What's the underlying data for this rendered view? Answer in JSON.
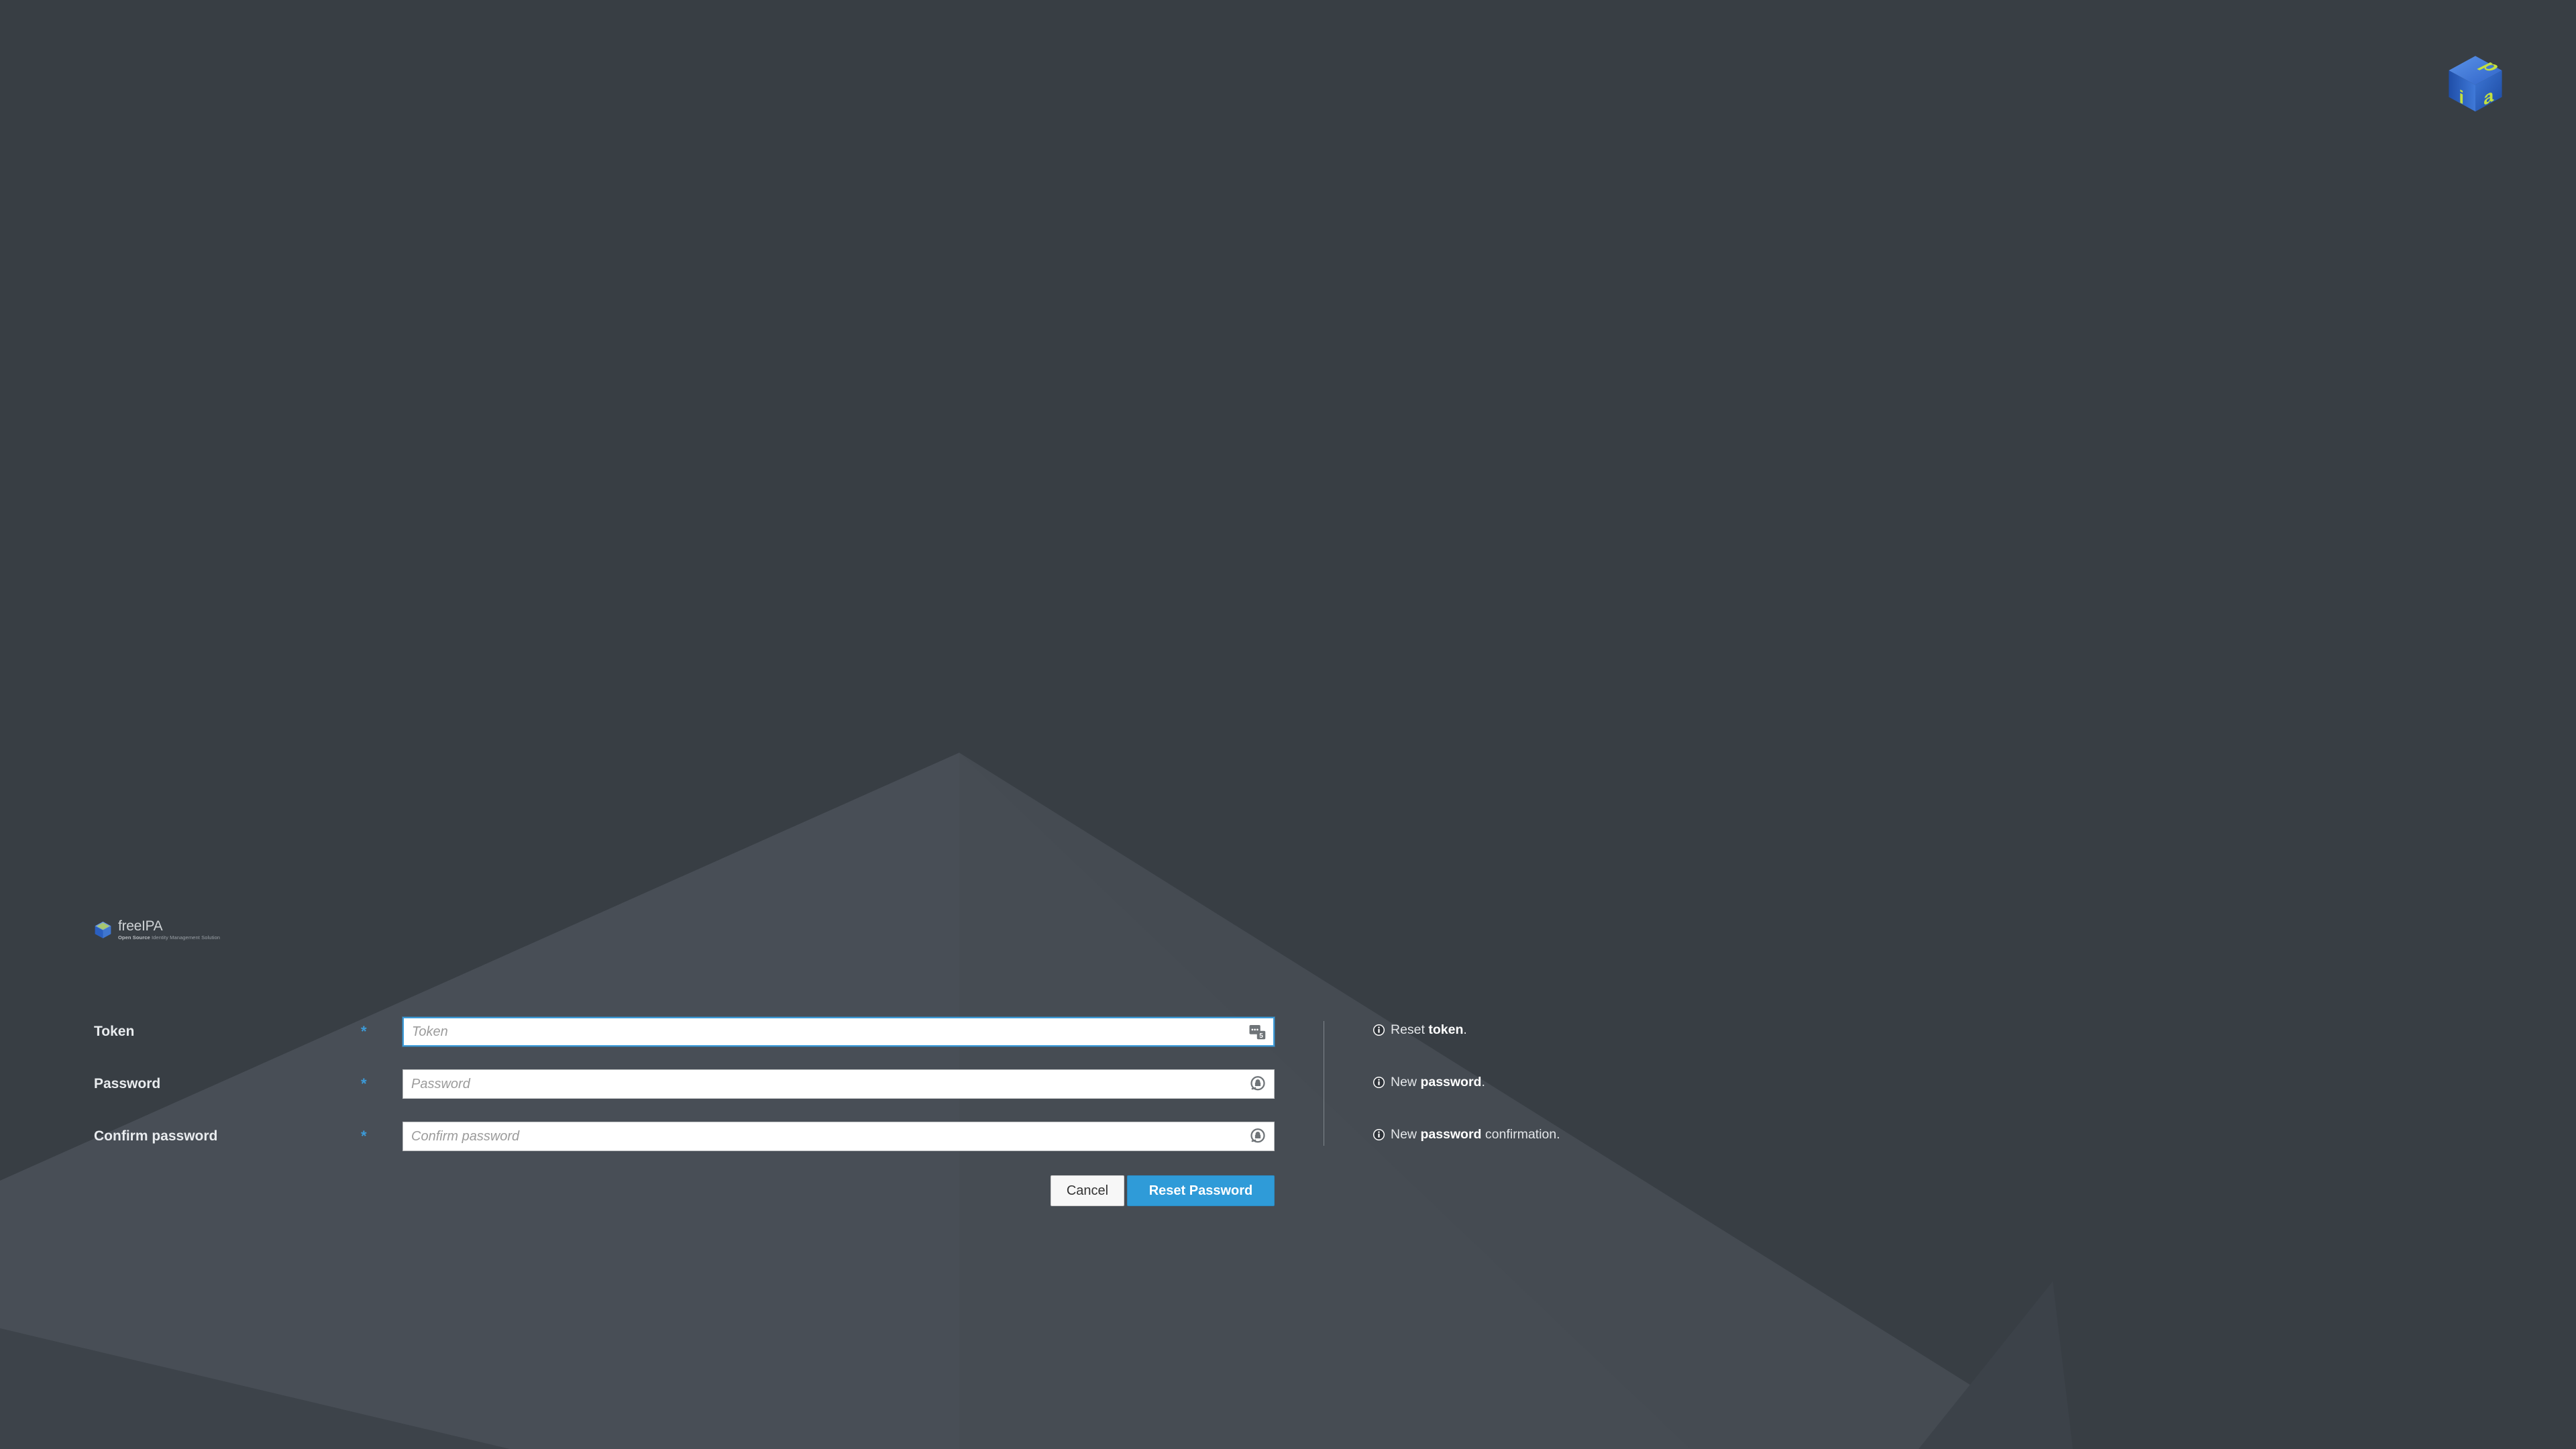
{
  "page": {
    "title": "FreeIPA Reset Password",
    "background_color": "#383e44",
    "accent_color": "#3c9bd9"
  },
  "app_logo": {
    "icon": "ipa-cube-icon",
    "face_letters": [
      "i",
      "p",
      "a"
    ],
    "cube_blue": "#2f6fd0",
    "letter_green": "#b5d33a"
  },
  "brand": {
    "icon": "freeipa-cube-icon",
    "name": "freeIPA",
    "tagline_bold": "Open Source",
    "tagline_rest": " Identity Management Solution"
  },
  "form": {
    "fields": [
      {
        "label": "Token",
        "required_marker": "*",
        "placeholder": "Token",
        "value": "",
        "focused": true,
        "affix_icon": "autofill-card-icon"
      },
      {
        "label": "Password",
        "required_marker": "*",
        "placeholder": "Password",
        "value": "",
        "focused": false,
        "affix_icon": "password-key-icon"
      },
      {
        "label": "Confirm password",
        "required_marker": "*",
        "placeholder": "Confirm password",
        "value": "",
        "focused": false,
        "affix_icon": "password-key-icon"
      }
    ],
    "buttons": {
      "cancel_label": "Cancel",
      "submit_label": "Reset Password"
    }
  },
  "hints": [
    {
      "icon": "info-circle-icon",
      "prefix": "Reset ",
      "bold": "token",
      "suffix": "."
    },
    {
      "icon": "info-circle-icon",
      "prefix": "New ",
      "bold": "password",
      "suffix": "."
    },
    {
      "icon": "info-circle-icon",
      "prefix": "New ",
      "bold": "password",
      "suffix": " confirmation."
    }
  ]
}
